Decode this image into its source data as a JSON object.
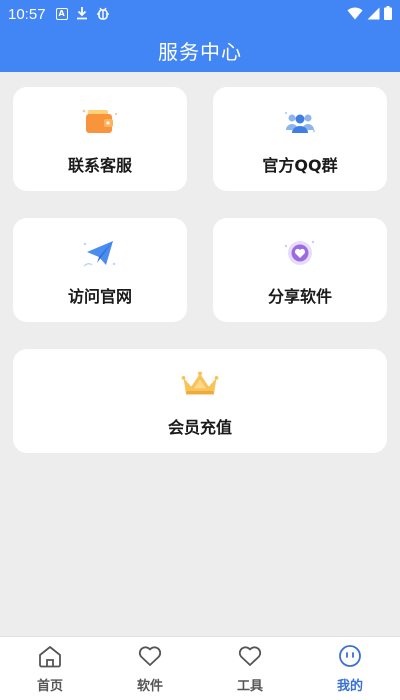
{
  "status_bar": {
    "time": "10:57",
    "icons": [
      "a-icon",
      "download-icon",
      "bug-icon",
      "wifi-icon",
      "signal-icon",
      "battery-icon"
    ]
  },
  "header": {
    "title": "服务中心"
  },
  "cards": [
    {
      "id": "contact",
      "label": "联系客服",
      "icon": "wallet-icon"
    },
    {
      "id": "qq",
      "label": "官方QQ群",
      "icon": "group-icon"
    },
    {
      "id": "web",
      "label": "访问官网",
      "icon": "paper-plane-icon"
    },
    {
      "id": "share",
      "label": "分享软件",
      "icon": "heart-badge-icon"
    },
    {
      "id": "vip",
      "label": "会员充值",
      "icon": "crown-icon"
    }
  ],
  "bottom_nav": {
    "items": [
      {
        "label": "首页",
        "icon": "home-icon",
        "active": false
      },
      {
        "label": "软件",
        "icon": "heart-icon",
        "active": false
      },
      {
        "label": "工具",
        "icon": "heart-icon",
        "active": false
      },
      {
        "label": "我的",
        "icon": "smiley-icon",
        "active": true
      }
    ]
  },
  "colors": {
    "primary": "#4285f4",
    "background": "#ededed",
    "card": "#ffffff",
    "active_nav": "#3a6fd8"
  }
}
